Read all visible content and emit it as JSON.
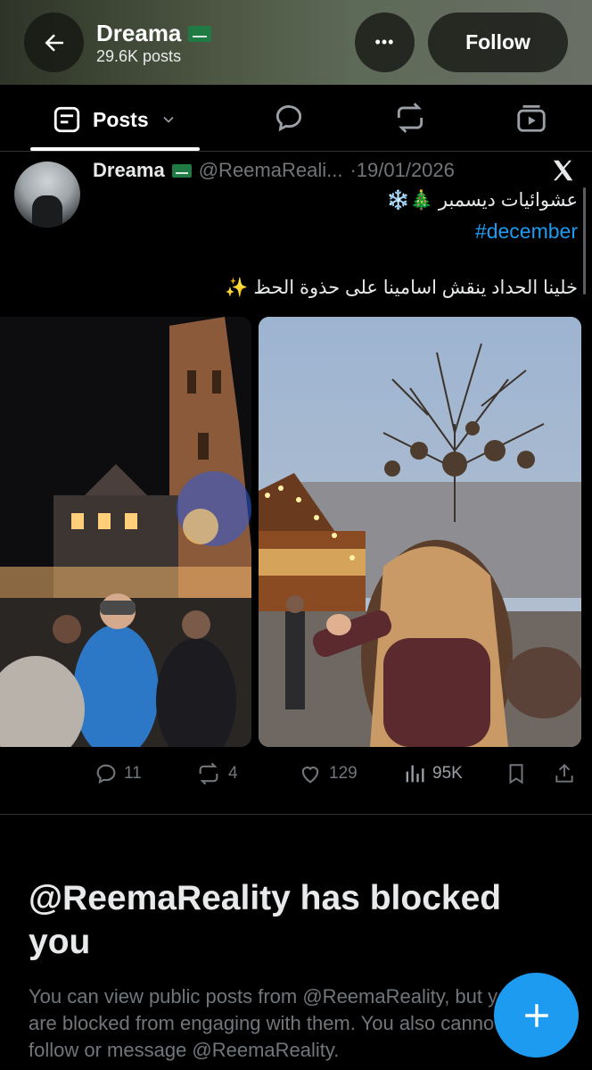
{
  "header": {
    "name": "Dreama",
    "posts_count": "29.6K posts",
    "follow_label": "Follow",
    "more_label": "•••"
  },
  "tabs": {
    "posts_label": "Posts"
  },
  "post": {
    "author_name": "Dreama",
    "handle": "@ReemaReali...",
    "date": "·19/01/2026",
    "line1": "عشوائيات ديسمبر 🎄❄️",
    "hashtag": "#december",
    "line2": "خلينا الحداد ينقش اسامينا على حذوة الحظ ✨",
    "replies": "11",
    "reposts": "4",
    "likes": "129",
    "views": "95K"
  },
  "blocked": {
    "title": "@ReemaReality has blocked you",
    "text": "You can view public posts from @ReemaReality, but you are blocked from engaging with them. You also cannot follow or message @ReemaReality."
  },
  "colors": {
    "accent": "#1d9bf0",
    "muted": "#71767b",
    "background": "#000000"
  }
}
